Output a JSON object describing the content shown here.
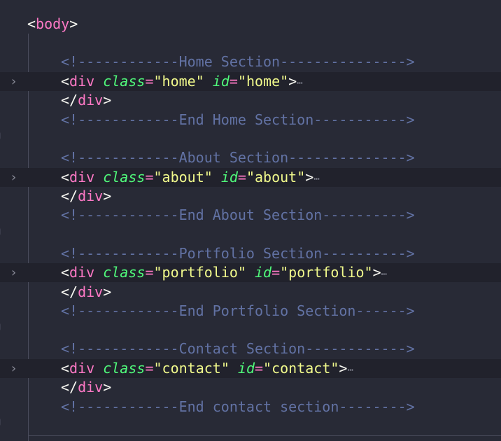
{
  "editor": {
    "body_open_tag": "body",
    "sections": [
      {
        "comment_start": "<!------------Home Section--------------->",
        "tag": "div",
        "class_attr": "class",
        "class_value": "\"home\"",
        "id_attr": "id",
        "id_value": "\"home\"",
        "close_tag": "div",
        "comment_end": "<!------------End Home Section----------->"
      },
      {
        "comment_start": "<!------------About Section-------------->",
        "tag": "div",
        "class_attr": "class",
        "class_value": "\"about\"",
        "id_attr": "id",
        "id_value": "\"about\"",
        "close_tag": "div",
        "comment_end": "<!------------End About Section---------->"
      },
      {
        "comment_start": "<!------------Portfolio Section---------->",
        "tag": "div",
        "class_attr": "class",
        "class_value": "\"portfolio\"",
        "id_attr": "id",
        "id_value": "\"portfolio\"",
        "close_tag": "div",
        "comment_end": "<!------------End Portfolio Section------>"
      },
      {
        "comment_start": "<!------------Contact Section------------>",
        "tag": "div",
        "class_attr": "class",
        "class_value": "\"contact\"",
        "id_attr": "id",
        "id_value": "\"contact\"",
        "close_tag": "div",
        "comment_end": "<!------------End contact section-------->"
      }
    ],
    "fold_icon": "chevron-right-icon",
    "ellipsis": "⋯"
  },
  "colors": {
    "background": "#282a36",
    "tag": "#ff79c6",
    "attribute": "#50fa7b",
    "string": "#f1fa8c",
    "comment": "#6272a4",
    "text": "#f8f8f2"
  }
}
